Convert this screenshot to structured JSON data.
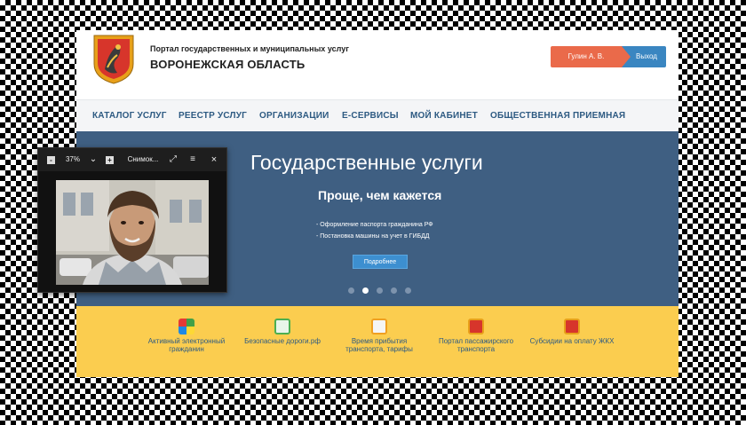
{
  "header": {
    "subtitle": "Портал государственных и муниципальных услуг",
    "title": "ВОРОНЕЖСКАЯ ОБЛАСТЬ",
    "user_name": "Гулин А. В.",
    "exit_label": "Выход"
  },
  "nav": {
    "items": [
      {
        "label": "КАТАЛОГ УСЛУГ"
      },
      {
        "label": "РЕЕСТР УСЛУГ"
      },
      {
        "label": "ОРГАНИЗАЦИИ"
      },
      {
        "label": "Е-СЕРВИСЫ"
      },
      {
        "label": "МОЙ КАБИНЕТ"
      },
      {
        "label": "ОБЩЕСТВЕННАЯ ПРИЕМНАЯ"
      }
    ]
  },
  "hero": {
    "title": "Государственные услуги",
    "subtitle": "Проще, чем кажется",
    "bullets": [
      "- Оформление паспорта гражданина РФ",
      "- Постановка машины на учет в ГИБДД"
    ],
    "button_label": "Подробнее",
    "slides_count": 5,
    "active_slide": 2
  },
  "services": {
    "items": [
      {
        "label": "Активный электронный гражданин"
      },
      {
        "label": "Безопасные дороги.рф"
      },
      {
        "label": "Время прибытия транспорта, тарифы"
      },
      {
        "label": "Портал пассажирского транспорта"
      },
      {
        "label": "Субсидии на оплату ЖКХ"
      }
    ]
  },
  "viewer": {
    "zoom": "37%",
    "title": "Снимок...",
    "minus": "-",
    "plus": "+",
    "chevron": "⌄",
    "menu": "≡",
    "expand": "⤢",
    "close": "×"
  },
  "colors": {
    "nav_text": "#2d5a82",
    "hero_bg": "#3f5f82",
    "services_bg": "#fbcd4f",
    "user_btn": "#ea6a4a",
    "exit_btn": "#3a86c1",
    "more_btn": "#3d8fd0"
  }
}
